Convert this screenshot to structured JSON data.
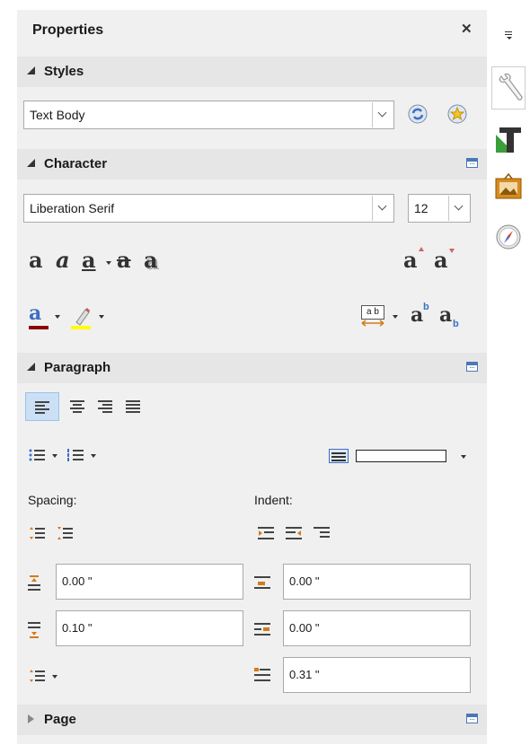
{
  "panel": {
    "title": "Properties",
    "close_glyph": "✕"
  },
  "styles": {
    "header": "Styles",
    "style_value": "Text Body",
    "update_icon": "update-style-icon",
    "new_icon": "new-style-icon"
  },
  "character": {
    "header": "Character",
    "font_name": "Liberation Serif",
    "font_size": "12",
    "format_glyphs": {
      "bold": "a",
      "italic": "a",
      "underline": "a",
      "strikethrough": "a",
      "shadow": "a",
      "grow": "a",
      "shrink": "a",
      "font_color": "a",
      "superscript": "a",
      "subscript": "a"
    },
    "superscript_mark": "b",
    "subscript_mark": "b",
    "spacing_text": "a b"
  },
  "paragraph": {
    "header": "Paragraph",
    "spacing_label": "Spacing:",
    "indent_label": "Indent:",
    "above_spacing": "0.00 \"",
    "below_spacing": "0.10 \"",
    "before_indent": "0.00 \"",
    "after_indent": "0.00 \"",
    "first_line_indent": "0.31 \""
  },
  "page": {
    "header": "Page"
  },
  "colors": {
    "accent": "#4a78b8",
    "font_color_bar": "#8b0000",
    "highlight_bar": "#ffff00"
  }
}
